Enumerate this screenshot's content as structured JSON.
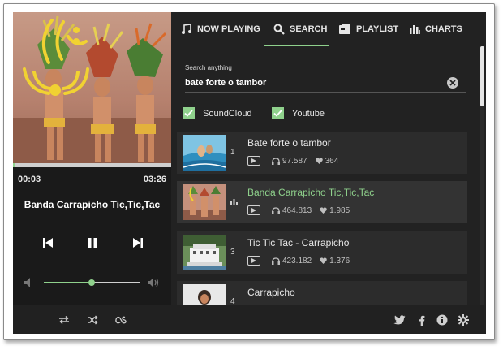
{
  "player": {
    "time_elapsed": "00:03",
    "time_total": "03:26",
    "progress": 0.015,
    "track_title": "Banda Carrapicho Tic,Tic,Tac",
    "volume": 0.5
  },
  "tabs": [
    {
      "label": "NOW PLAYING",
      "icon": "music-note-icon"
    },
    {
      "label": "SEARCH",
      "icon": "search-icon",
      "active": true
    },
    {
      "label": "PLAYLIST",
      "icon": "playlist-icon"
    },
    {
      "label": "CHARTS",
      "icon": "charts-icon"
    }
  ],
  "search": {
    "label": "Search anything",
    "value": "bate forte o tambor",
    "placeholder": ""
  },
  "sources": [
    {
      "label": "SoundCloud",
      "checked": true
    },
    {
      "label": "Youtube",
      "checked": true
    }
  ],
  "results": [
    {
      "number": "1",
      "title": "Bate forte o tambor",
      "plays": "97.587",
      "likes": "364"
    },
    {
      "number": "",
      "title": "Banda Carrapicho Tic,Tic,Tac",
      "plays": "464.813",
      "likes": "1.985",
      "playing": true
    },
    {
      "number": "3",
      "title": "Tic Tic Tac - Carrapicho",
      "plays": "423.182",
      "likes": "1.376"
    },
    {
      "number": "4",
      "title": "Carrapicho",
      "plays": "",
      "likes": ""
    }
  ],
  "colors": {
    "accent": "#8fd18c",
    "background": "#1e1e1e",
    "panel": "#222222",
    "row": "#2c2c2c"
  }
}
